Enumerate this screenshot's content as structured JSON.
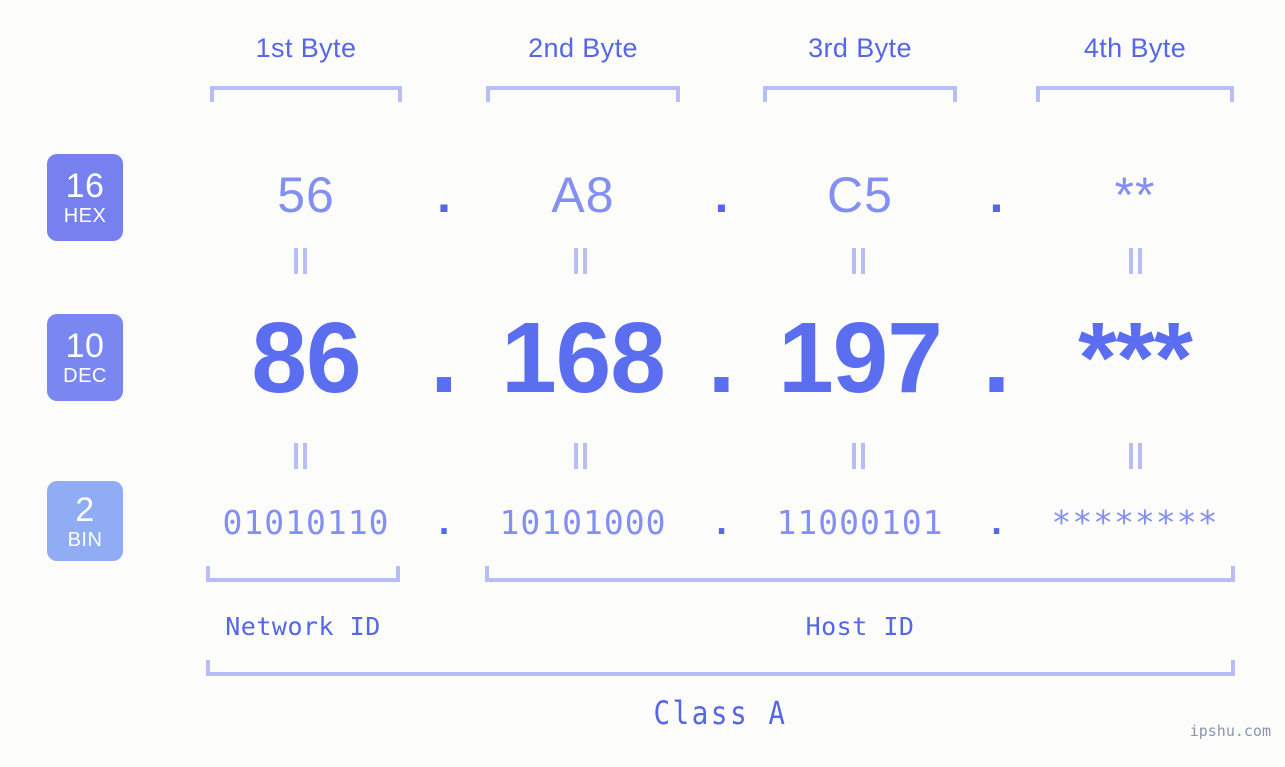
{
  "meta": {
    "watermark": "ipshu.com",
    "background_color": "#fcfdfa",
    "accent_color": "#5566e8",
    "accent_light_color": "#8390f2",
    "bracket_color": "#b6bdf7",
    "badge_color": "#7681ef",
    "badge_bin_color": "#8facf4"
  },
  "byte_headers": [
    {
      "label": "1st Byte"
    },
    {
      "label": "2nd Byte"
    },
    {
      "label": "3rd Byte"
    },
    {
      "label": "4th Byte"
    }
  ],
  "rows": {
    "hex": {
      "radix_num": "16",
      "radix_name": "HEX",
      "values": [
        "56",
        "A8",
        "C5",
        "**"
      ],
      "separator": "."
    },
    "dec": {
      "radix_num": "10",
      "radix_name": "DEC",
      "values": [
        "86",
        "168",
        "197",
        "***"
      ],
      "separator": "."
    },
    "bin": {
      "radix_num": "2",
      "radix_name": "BIN",
      "values": [
        "01010110",
        "10101000",
        "11000101",
        "********"
      ],
      "separator": "."
    }
  },
  "equals_symbol": "=",
  "segments": {
    "network_id": "Network ID",
    "host_id": "Host ID",
    "class": "Class A"
  }
}
